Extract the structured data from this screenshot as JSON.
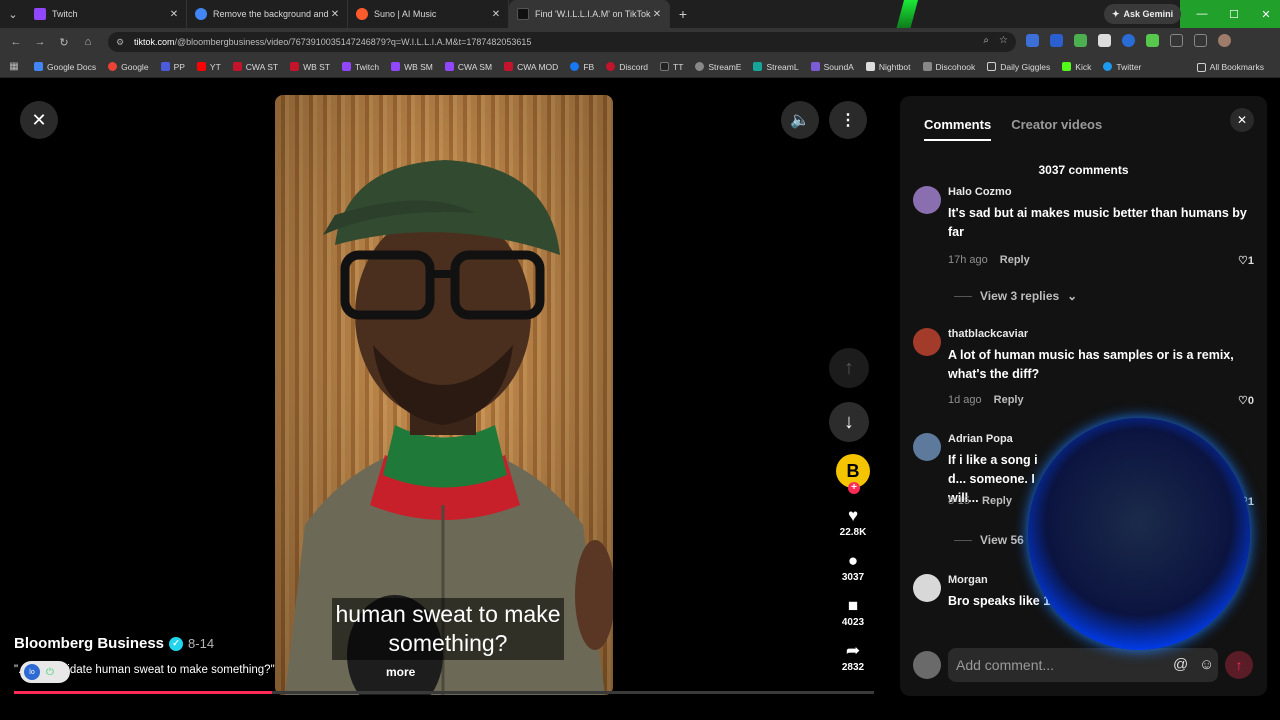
{
  "browser": {
    "tabs": [
      {
        "title": "Twitch",
        "color": "#9146ff",
        "active": false
      },
      {
        "title": "Remove the background and m",
        "color": "#4285f4",
        "active": false
      },
      {
        "title": "Suno | AI Music",
        "color": "#ff5a2c",
        "active": false
      },
      {
        "title": "Find 'W.I.L.L.I.A.M' on TikTok",
        "color": "#111111",
        "active": true
      }
    ],
    "gemini_label": "Ask Gemini",
    "url_host": "tiktok.com",
    "url_path": "/@bloombergbusiness/video/7673910035147246879?q=W.I.L.L.I.A.M&t=1787482053615",
    "bookmarks": [
      {
        "label": "Google Docs",
        "color": "#4285f4"
      },
      {
        "label": "Google",
        "color": "#ea4335"
      },
      {
        "label": "PP",
        "color": "#4a5bdc"
      },
      {
        "label": "YT",
        "color": "#ff0000"
      },
      {
        "label": "CWA ST",
        "color": "#c4142b"
      },
      {
        "label": "WB ST",
        "color": "#c4142b"
      },
      {
        "label": "Twitch",
        "color": "#9146ff"
      },
      {
        "label": "WB SM",
        "color": "#9146ff"
      },
      {
        "label": "CWA SM",
        "color": "#9146ff"
      },
      {
        "label": "CWA MOD",
        "color": "#c4142b"
      },
      {
        "label": "FB",
        "color": "#1877f2"
      },
      {
        "label": "Discord",
        "color": "#c4142b"
      },
      {
        "label": "TT",
        "color": "#222222"
      },
      {
        "label": "StreamE",
        "color": "#888888"
      },
      {
        "label": "StreamL",
        "color": "#15a59a"
      },
      {
        "label": "SoundA",
        "color": "#7c5bd6"
      },
      {
        "label": "Nightbot",
        "color": "#dddddd"
      },
      {
        "label": "Discohook",
        "color": "#888888"
      },
      {
        "label": "Daily Giggles",
        "color": "#cfcfcf"
      },
      {
        "label": "Kick",
        "color": "#53fc18"
      },
      {
        "label": "Twitter",
        "color": "#1d9bf0"
      }
    ],
    "all_bookmarks": "All Bookmarks"
  },
  "video": {
    "caption": "human sweat to make something?",
    "creator": "Bloomberg Business",
    "date": "8-14",
    "description": "\"... you validate human sweat to make something?\"",
    "more_label": "more",
    "progress": 0.3,
    "counts": {
      "likes": "22.8K",
      "comments": "3037",
      "saves": "4023",
      "shares": "2832"
    },
    "creator_initial": "B"
  },
  "comments_panel": {
    "tabs": [
      "Comments",
      "Creator videos"
    ],
    "count_label": "3037 comments",
    "comments": [
      {
        "user": "Halo Cozmo",
        "text": "It's sad but ai makes music better than humans by far",
        "time": "17h ago",
        "reply": "Reply",
        "likes": "1",
        "replies_label": "View 3 replies",
        "avatar": "#8a6fb0"
      },
      {
        "user": "thatblackcaviar",
        "text": "A lot of human music has samples or is a remix, what's the diff?",
        "time": "1d ago",
        "reply": "Reply",
        "likes": "0",
        "avatar": "#a33b2b"
      },
      {
        "user": "Adrian Popa",
        "text": "If i like a song i d... someone. I will...",
        "time": "8-15",
        "reply": "Reply",
        "likes": "1",
        "replies_label": "View 56",
        "avatar": "#5d7a9c"
      },
      {
        "user": "Morgan",
        "text": "Bro speaks like 1... ...uter edited. 😂",
        "avatar": "#d8d8d8"
      }
    ],
    "add_placeholder": "Add comment..."
  }
}
